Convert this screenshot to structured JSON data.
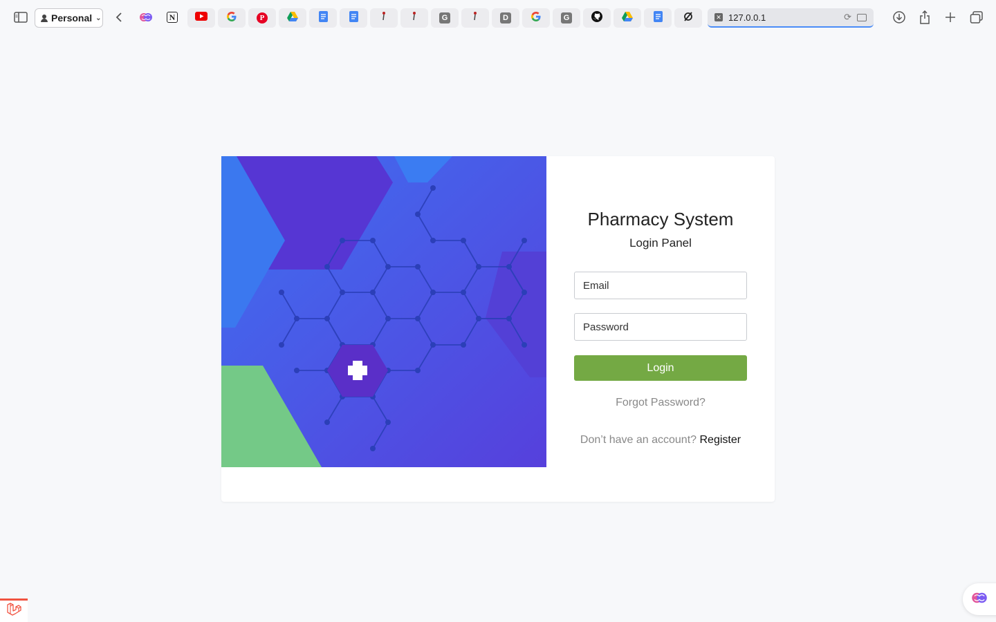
{
  "browser": {
    "profile_label": "Personal",
    "address_url": "127.0.0.1",
    "tabs": [
      {
        "icon": "brain-icon"
      },
      {
        "icon": "notion-icon",
        "glyph": "N"
      },
      {
        "icon": "youtube-icon"
      },
      {
        "icon": "google-icon",
        "glyph": "G"
      },
      {
        "icon": "pinterest-icon",
        "glyph": "P"
      },
      {
        "icon": "google-drive-icon"
      },
      {
        "icon": "google-docs-icon"
      },
      {
        "icon": "google-docs-icon"
      },
      {
        "icon": "figure-icon"
      },
      {
        "icon": "figure-icon"
      },
      {
        "icon": "gray-g-icon",
        "glyph": "G"
      },
      {
        "icon": "figure-icon"
      },
      {
        "icon": "gray-d-icon",
        "glyph": "D"
      },
      {
        "icon": "google-icon",
        "glyph": "G"
      },
      {
        "icon": "gray-g-icon",
        "glyph": "G"
      },
      {
        "icon": "github-icon"
      },
      {
        "icon": "google-drive-icon"
      },
      {
        "icon": "google-docs-icon"
      },
      {
        "icon": "empty-set-icon"
      }
    ]
  },
  "login": {
    "title": "Pharmacy System",
    "subtitle": "Login Panel",
    "email_placeholder": "Email",
    "password_placeholder": "Password",
    "login_button": "Login",
    "forgot_password": "Forgot Password?",
    "register_prompt": "Don’t have an account?",
    "register_link": "Register"
  },
  "colors": {
    "login_button": "#74a944",
    "hero_blue": "#4a5fe0",
    "hero_purple": "#5636d3",
    "hero_green": "#74c987",
    "address_focus": "#4a8cf7"
  }
}
